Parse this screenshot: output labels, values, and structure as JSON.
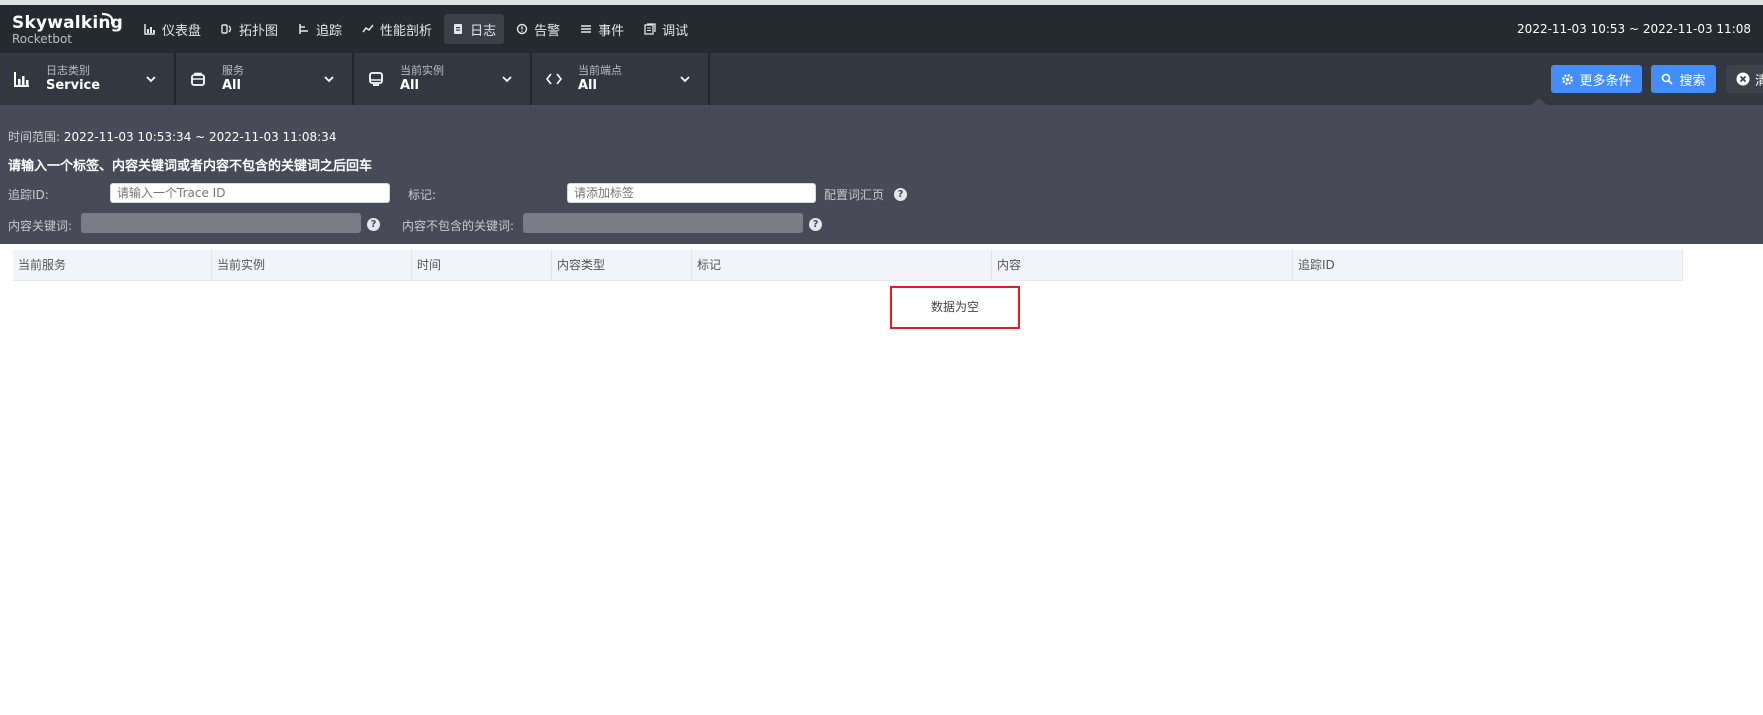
{
  "app": {
    "logo_line1": "Skywalking",
    "logo_line2": "Rocketbot",
    "time_range": "2022-11-03 10:53 ~ 2022-11-03 11:08"
  },
  "nav": {
    "items": [
      {
        "label": "仪表盘",
        "icon": "chart-icon"
      },
      {
        "label": "拓扑图",
        "icon": "topology-icon"
      },
      {
        "label": "追踪",
        "icon": "trace-icon"
      },
      {
        "label": "性能剖析",
        "icon": "profile-icon"
      },
      {
        "label": "日志",
        "icon": "log-icon",
        "active": true
      },
      {
        "label": "告警",
        "icon": "alarm-icon"
      },
      {
        "label": "事件",
        "icon": "event-icon"
      },
      {
        "label": "调试",
        "icon": "debug-icon"
      }
    ]
  },
  "toolbar": {
    "selectors": [
      {
        "label": "日志类别",
        "value": "Service"
      },
      {
        "label": "服务",
        "value": "All"
      },
      {
        "label": "当前实例",
        "value": "All"
      },
      {
        "label": "当前端点",
        "value": "All"
      }
    ],
    "more_label": "更多条件",
    "search_label": "搜索",
    "clear_label": "清"
  },
  "panel": {
    "time_label": "时间范围:",
    "time_value": "2022-11-03 10:53:34 ~ 2022-11-03 11:08:34",
    "hint": "请输入一个标签、内容关键词或者内容不包含的关键词之后回车",
    "trace_label": "追踪ID:",
    "trace_placeholder": "请输入一个Trace ID",
    "tag_label": "标记:",
    "tag_placeholder": "请添加标签",
    "config_label": "配置词汇页",
    "keyword_label": "内容关键词:",
    "exclude_label": "内容不包含的关键词:"
  },
  "table": {
    "headers": [
      "当前服务",
      "当前实例",
      "时间",
      "内容类型",
      "标记",
      "内容",
      "追踪ID"
    ],
    "empty_text": "数据为空"
  },
  "colors": {
    "header_bg": "#252a2f",
    "toolbar_bg": "#333840",
    "panel_bg": "#484b57",
    "accent": "#448dfe",
    "highlight": "#e01c24"
  }
}
